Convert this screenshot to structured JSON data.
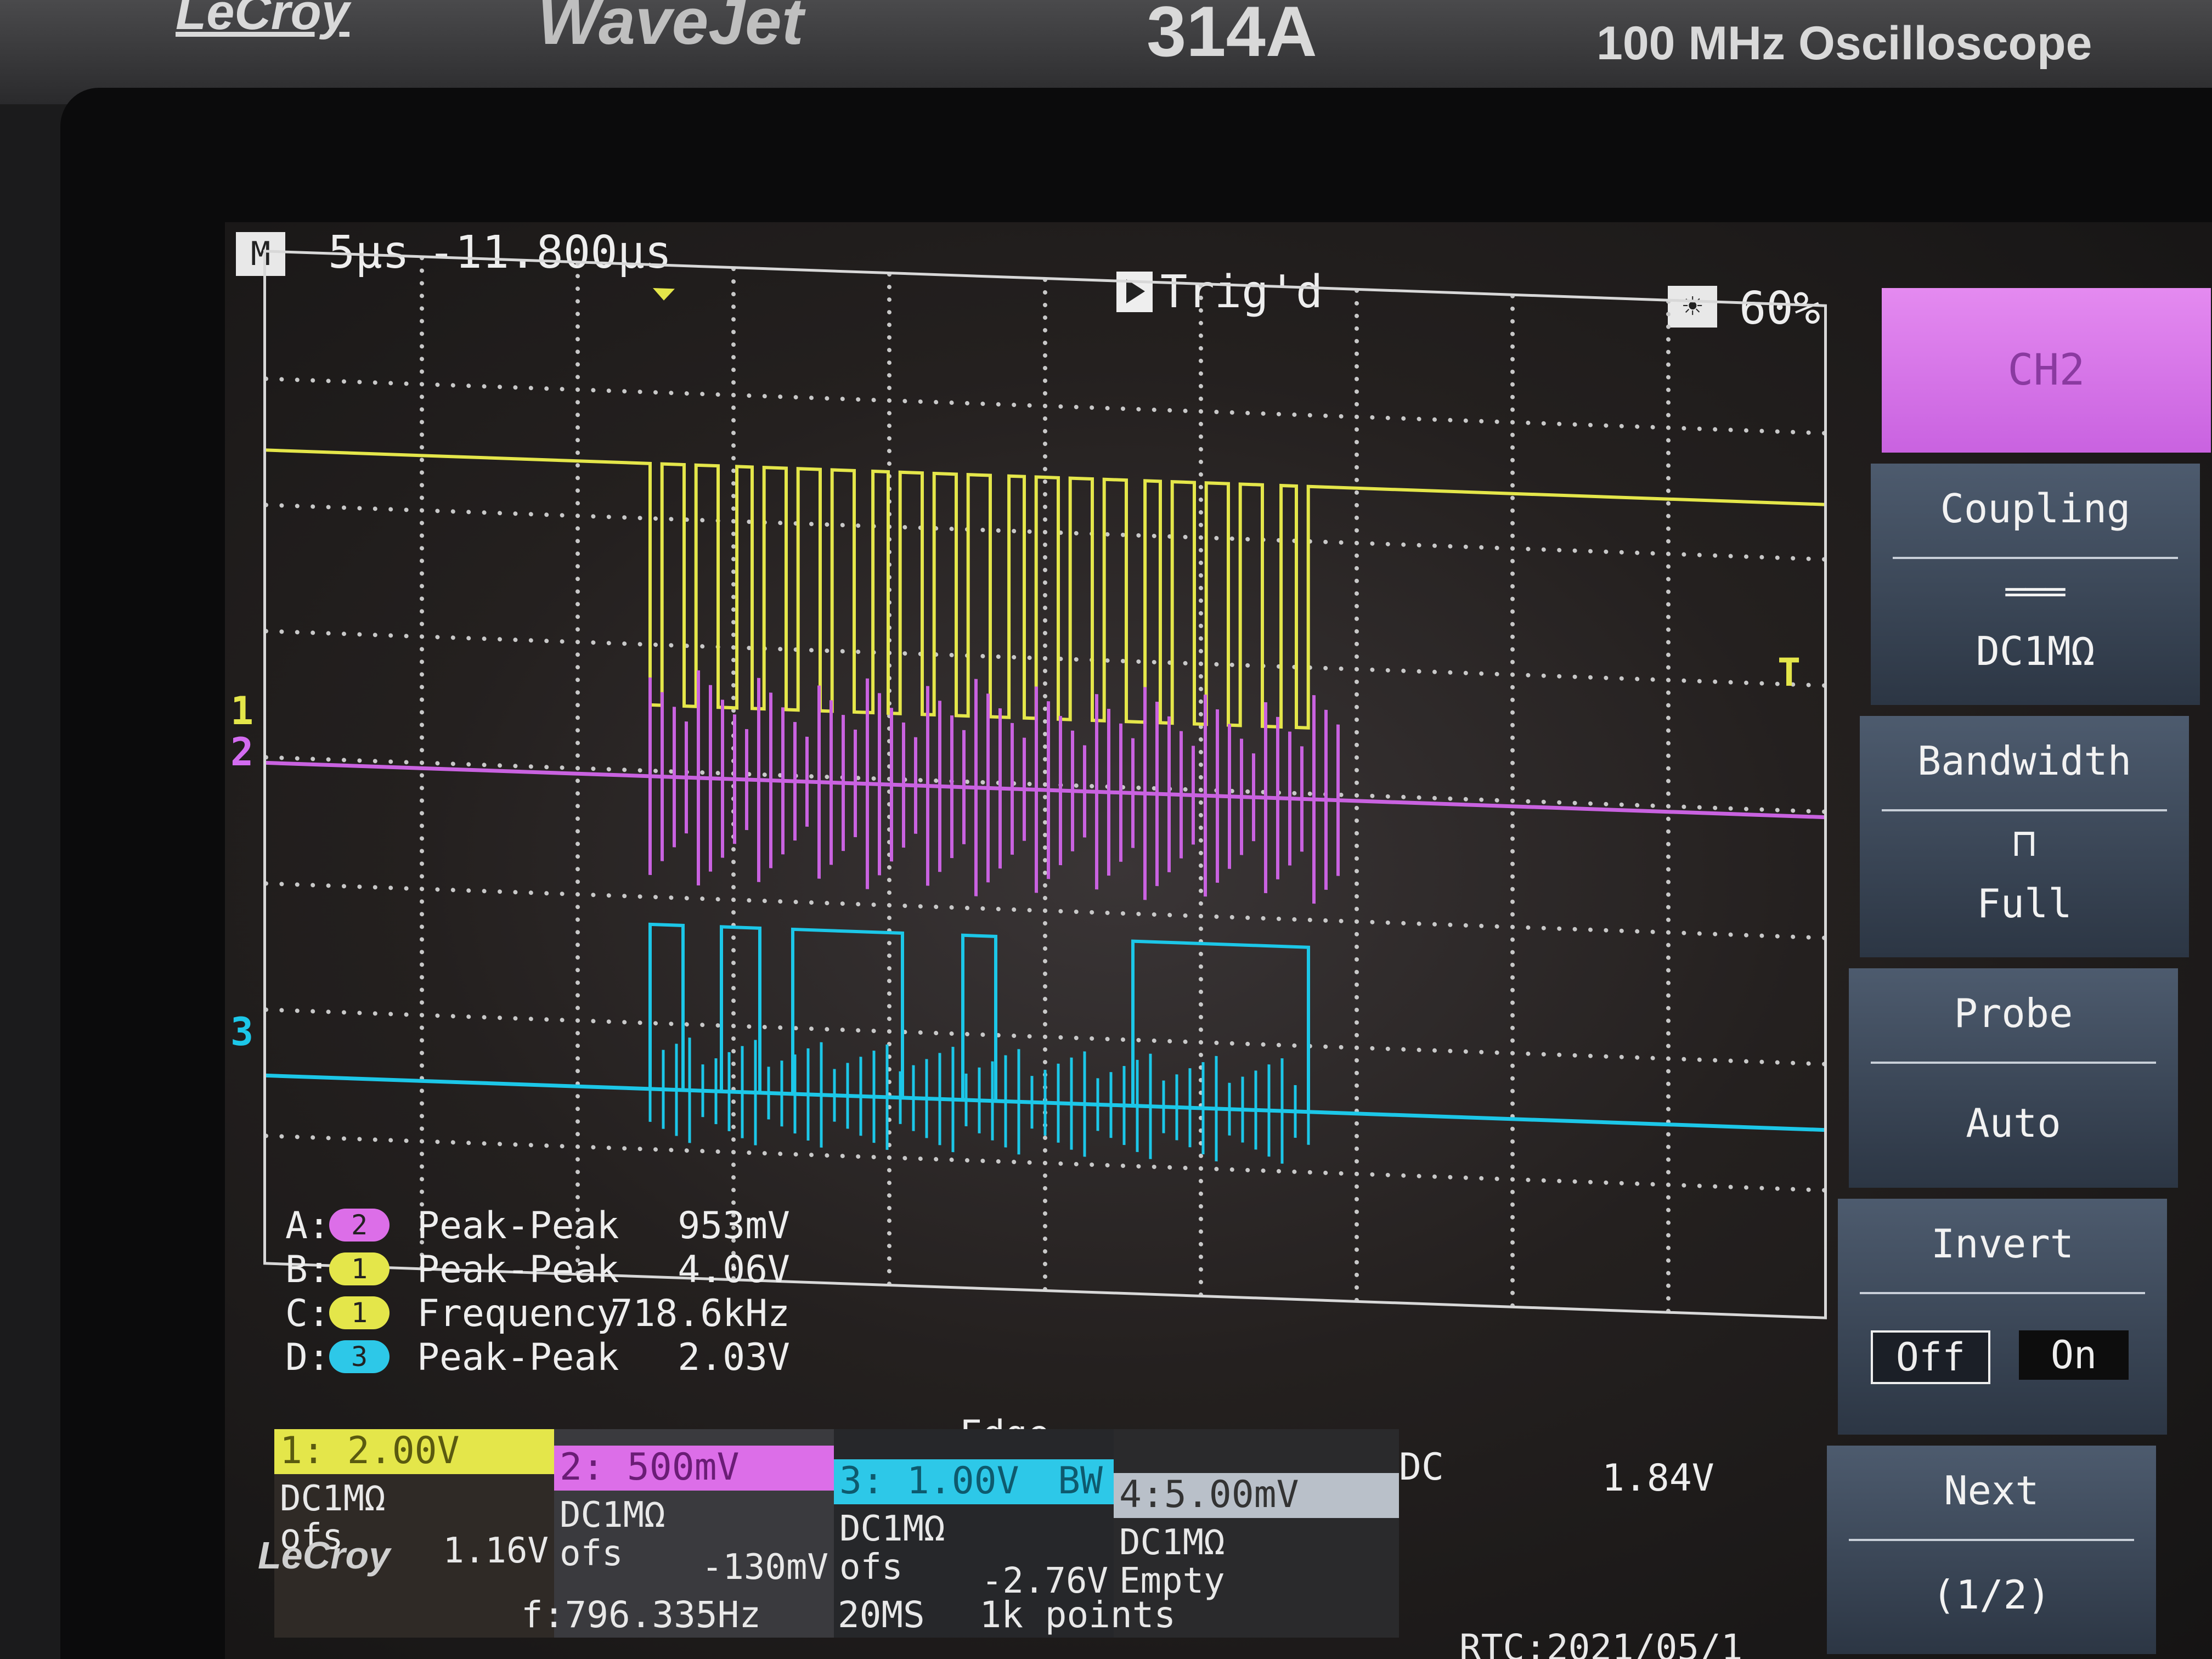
{
  "device": {
    "brand": "LeCroy",
    "series": "WaveJet",
    "model": "314A",
    "description": "100 MHz Oscilloscope"
  },
  "status": {
    "mode_icon": "M",
    "timebase": "5µs",
    "trigger_delay": "-11.800µs",
    "trigger_state": "Trig'd",
    "intensity": "60%"
  },
  "channel_markers": {
    "ch1": "1",
    "ch2": "2",
    "ch3": "3",
    "trigger": "T"
  },
  "measurements": [
    {
      "slot": "A:",
      "channel": "2",
      "name": "Peak-Peak",
      "value": "953mV",
      "color": "#dc6ee8"
    },
    {
      "slot": "B:",
      "channel": "1",
      "name": "Peak-Peak",
      "value": "4.06V",
      "color": "#e4e64a"
    },
    {
      "slot": "C:",
      "channel": "1",
      "name": "Frequency",
      "value": "718.6kHz",
      "color": "#e4e64a"
    },
    {
      "slot": "D:",
      "channel": "3",
      "name": "Peak-Peak",
      "value": "2.03V",
      "color": "#2dc8e8"
    }
  ],
  "channels": [
    {
      "head": "1: 2.00V",
      "coupling": "DC1MΩ",
      "ofs_label": "ofs",
      "ofs_value": "1.16V",
      "color": "#e4e64a"
    },
    {
      "head": "2: 500mV",
      "coupling": "DC1MΩ",
      "ofs_label": "ofs",
      "ofs_value": "-130mV",
      "color": "#dc6ee8"
    },
    {
      "head": "3: 1.00V",
      "bw": "BW",
      "coupling": "DC1MΩ",
      "ofs_label": "ofs",
      "ofs_value": "-2.76V",
      "color": "#2dc8e8"
    },
    {
      "head": "4:5.00mV",
      "coupling": "DC1MΩ",
      "ofs_label": "Empty",
      "ofs_value": "",
      "color": "#b9c0c9"
    }
  ],
  "trigger": {
    "type": "Edge",
    "source": "1",
    "coupling": "DC",
    "level": "1.84V"
  },
  "footer": {
    "logo": "LeCroy",
    "trigger_frequency": "f:796.335Hz",
    "sample_rate": "20MS",
    "record_length": "1k points",
    "rtc": "RTC:2021/05/1"
  },
  "menu": {
    "channel": "CH2",
    "coupling": {
      "title": "Coupling",
      "value": "DC1MΩ"
    },
    "bandwidth": {
      "title": "Bandwidth",
      "value": "Full"
    },
    "probe": {
      "title": "Probe",
      "value": "Auto"
    },
    "invert": {
      "title": "Invert",
      "off": "Off",
      "on": "On"
    },
    "next": {
      "title": "Next",
      "page": "(1/2)"
    }
  },
  "colors": {
    "ch1": "#e4e64a",
    "ch2": "#c962e0",
    "ch3": "#1cc7e8",
    "grid": "#d8d8d8"
  }
}
